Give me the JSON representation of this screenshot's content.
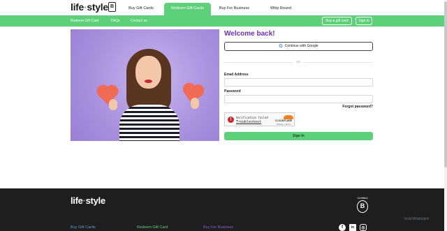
{
  "header": {
    "logo_text": "life",
    "logo_dot": "·",
    "logo_text2": "style",
    "bcorp_mark": "B",
    "tabs": [
      "Buy Gift Cards",
      "Redeem Gift Cards",
      "Buy For Business",
      "Whip Round"
    ],
    "active_tab": "Redeem Gift Cards"
  },
  "subnav": {
    "links": [
      "Redeem Gift Card",
      "FAQs",
      "Contact us"
    ],
    "buy_button": "Buy a gift card",
    "signin_button": "Sign in"
  },
  "form": {
    "title": "Welcome back!",
    "google_label": "Continue with Google",
    "google_icon": "google-g-icon",
    "divider": "OR",
    "email_label": "Email Address",
    "email_value": "",
    "password_label": "Password",
    "password_value": "",
    "forgot": "Forgot password?",
    "captcha": {
      "status": "Verification failed",
      "action": "Troubleshoot",
      "brand": "CLOUDFLARE",
      "links": "Privacy • Terms"
    },
    "submit": "Sign In"
  },
  "footer": {
    "logo_text": "life",
    "logo_dot": "·",
    "logo_text2": "style",
    "certified": "Certified",
    "bcorp_mark": "B",
    "links": [
      {
        "label": "Buy Gift Cards",
        "color": "#5b9bd5"
      },
      {
        "label": "Redeem Gift Card",
        "color": "#5ed07a"
      },
      {
        "label": "Buy For Business",
        "color": "#8e5bd6"
      }
    ],
    "social": [
      "facebook-icon",
      "linkedin-icon",
      "instagram-icon"
    ]
  },
  "watermark": "ScanMalware",
  "colors": {
    "brand_green": "#5ed07a",
    "brand_purple": "#6d2fbd",
    "footer_bg": "#1e1e1e"
  }
}
